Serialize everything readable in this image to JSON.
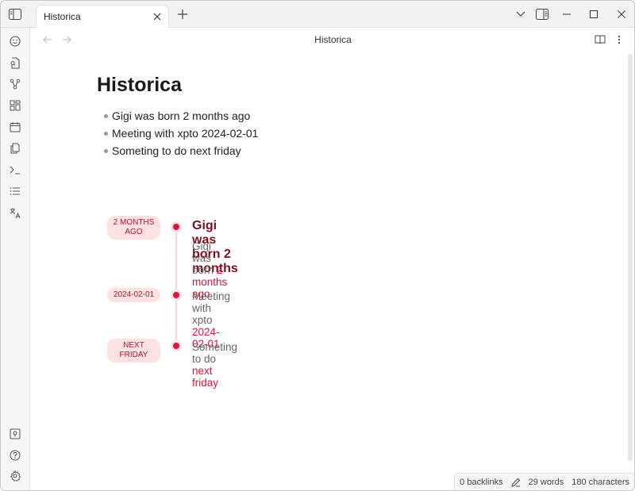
{
  "titlebar": {
    "tab_title": "Historica",
    "tab_close_icon": "close-icon",
    "new_tab_label": "+",
    "window_controls": [
      "chevron-down-icon",
      "sidebar-right-icon",
      "minimize-icon",
      "maximize-icon",
      "close-icon"
    ]
  },
  "ribbon": {
    "top_icons": [
      "smiley-icon",
      "file-search-icon",
      "graph-icon",
      "dashboard-icon",
      "calendar-icon",
      "copy-icon",
      "terminal-icon",
      "list-icon",
      "translate-icon"
    ],
    "bottom_icons": [
      "vault-icon",
      "help-icon",
      "settings-icon"
    ]
  },
  "view_header": {
    "back_icon": "arrow-left-icon",
    "forward_icon": "arrow-right-icon",
    "title": "Historica",
    "reading_view_icon": "book-open-icon",
    "more_options_icon": "more-vertical-icon"
  },
  "document": {
    "title": "Historica",
    "bullets": [
      "Gigi was born 2 months ago",
      "Meeting with xpto 2024-02-01",
      "Someting to do next friday"
    ]
  },
  "timeline": {
    "accent_color": "#dc143c",
    "tag_background": "#fde2e4",
    "events": [
      {
        "tag_line1": "2 months",
        "tag_line2": "ago",
        "heading": "Gigi was born 2 months",
        "text_prefix": "Gigi was born ",
        "text_highlight": "2 months ago"
      },
      {
        "tag_line1": "2024-02-01",
        "tag_line2": "",
        "heading": "",
        "text_prefix": "Meeting with xpto ",
        "text_highlight": "2024-02-01"
      },
      {
        "tag_line1": "next friday",
        "tag_line2": "",
        "heading": "",
        "text_prefix": "Someting to do ",
        "text_highlight": "next friday"
      }
    ]
  },
  "statusbar": {
    "backlinks": "0 backlinks",
    "edit_icon": "pencil-icon",
    "words": "29 words",
    "characters": "180 characters"
  }
}
